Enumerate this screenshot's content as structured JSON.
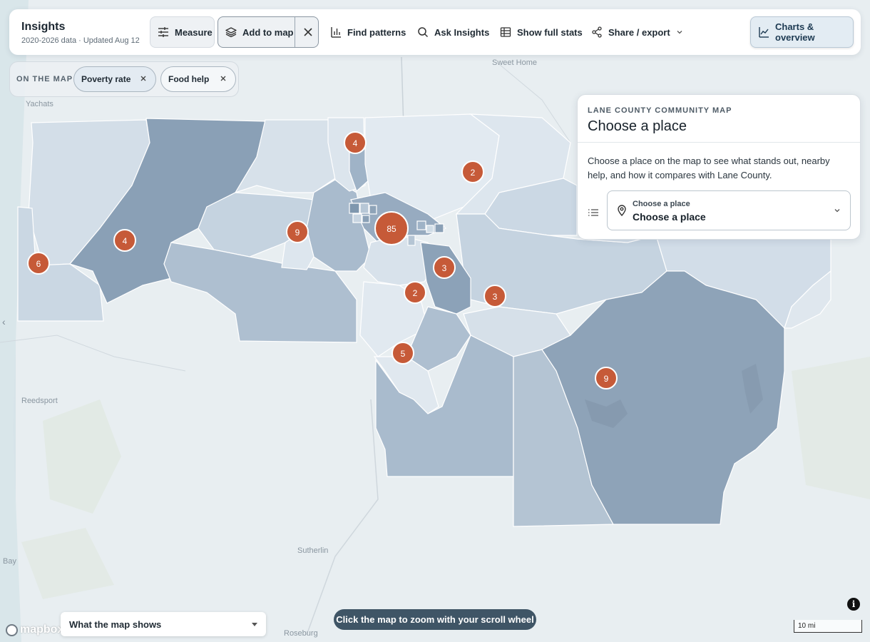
{
  "header": {
    "title": "Insights",
    "subtitle": "2020-2026 data · Updated Aug 12"
  },
  "toolbar": {
    "measure_label": "Measure",
    "add_to_map_label": "Add to map",
    "find_patterns_label": "Find patterns",
    "ask_insights_label": "Ask Insights",
    "show_stats_label": "Show full stats",
    "share_label": "Share / export",
    "charts_label": "Charts & overview"
  },
  "on_the_map": {
    "label": "ON THE MAP",
    "layers": [
      "Poverty rate",
      "Food help"
    ]
  },
  "panel": {
    "eyebrow": "LANE COUNTY COMMUNITY MAP",
    "title": "Choose a place",
    "description": "Choose a place on the map to see what stands out, nearby help, and how it compares with Lane County.",
    "select_label": "Choose a place",
    "select_value": "Choose a place"
  },
  "map": {
    "place_labels": [
      "Sweet Home",
      "Yachats",
      "Reedsport",
      "Sutherlin",
      "Roseburg",
      "Bay"
    ],
    "cluster_counts": [
      "4",
      "2",
      "9",
      "85",
      "4",
      "6",
      "3",
      "2",
      "3",
      "5",
      "9"
    ],
    "legend_label": "What the map shows",
    "zoom_hint": "Click the map to zoom with your scroll wheel",
    "scale_label": "10 mi",
    "attribution": "mapbox",
    "info_symbol": "i",
    "collapse_glyph": "‹",
    "colors": {
      "cluster": "#c65a38",
      "high": "#8aa0b6",
      "mid": "#a9bbcd",
      "low": "#c8d5e1",
      "lowest": "#dde6ee"
    }
  }
}
